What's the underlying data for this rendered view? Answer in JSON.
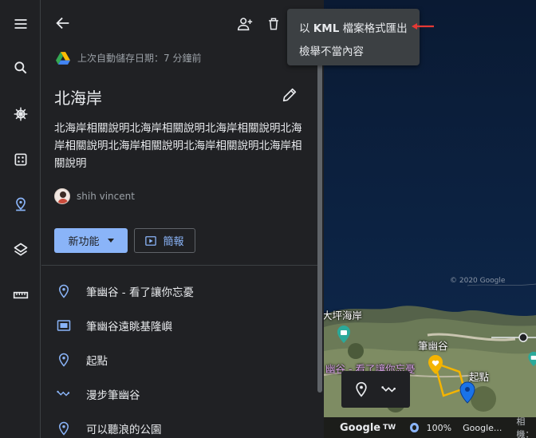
{
  "rail": {
    "items": [
      "menu",
      "search",
      "voyager",
      "feeling-lucky",
      "projects",
      "map-style",
      "measure"
    ]
  },
  "header": {
    "autosave_text": "上次自動儲存日期：7 分鐘前"
  },
  "project": {
    "title": "北海岸",
    "description": "北海岸相關說明北海岸相關說明北海岸相關說明北海岸相關說明北海岸相關說明北海岸相關說明北海岸相關說明",
    "author": "shih vincent"
  },
  "buttons": {
    "new_feature": "新功能",
    "present": "簡報"
  },
  "features": [
    {
      "label": "筆幽谷 - 看了讓你忘憂",
      "icon": "pin"
    },
    {
      "label": "筆幽谷遠眺基隆嶼",
      "icon": "slide"
    },
    {
      "label": "起點",
      "icon": "pin"
    },
    {
      "label": "漫步筆幽谷",
      "icon": "path"
    },
    {
      "label": "可以聽浪的公園",
      "icon": "pin"
    }
  ],
  "menu": {
    "export_prefix": "以",
    "export_kml": "KML",
    "export_suffix": "檔案格式匯出",
    "report": "檢舉不當內容"
  },
  "map": {
    "labels": {
      "coast": "大坪海岸",
      "valley": "筆幽谷",
      "start": "起點",
      "overlay": "幽谷 - 看了讓你忘憂",
      "copyright": "© 2020 Google"
    },
    "status": {
      "google": "Google",
      "tw": "TW",
      "zoom": "100%",
      "attribution": "Google...",
      "camera": "相機："
    }
  },
  "colors": {
    "accent": "#8ab4f8",
    "path": "#f4b400",
    "arrow": "#e53935"
  }
}
